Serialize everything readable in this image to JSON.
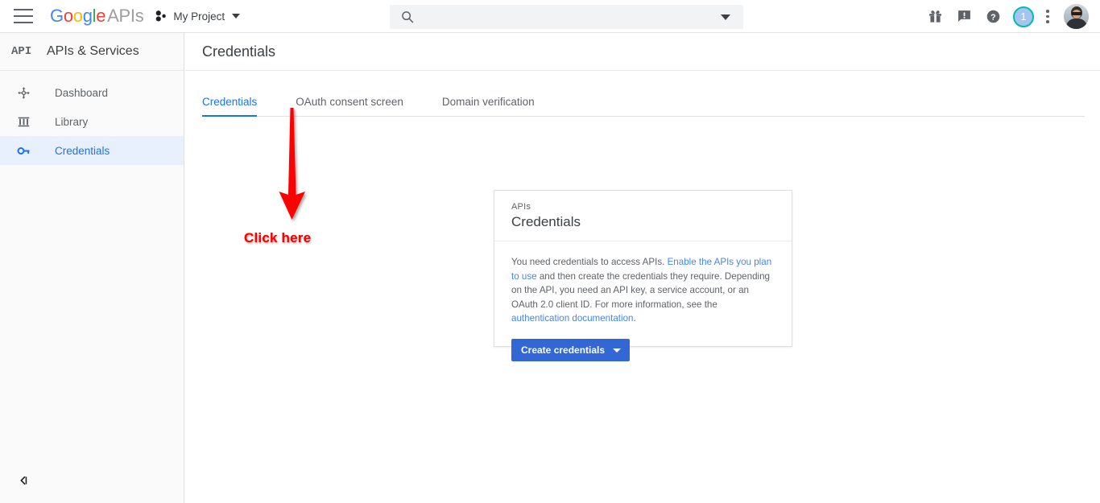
{
  "topbar": {
    "menu_icon": "hamburger-menu-icon",
    "brand": {
      "google": "Google",
      "apis": "APIs"
    },
    "project": {
      "icon": "project-cluster-icon",
      "name": "My Project"
    },
    "search": {
      "icon": "search-icon",
      "value": "",
      "placeholder": ""
    },
    "icons": [
      {
        "name": "gift-icon",
        "label": ""
      },
      {
        "name": "feedback-icon",
        "label": ""
      },
      {
        "name": "help-icon",
        "label": ""
      }
    ],
    "notification_badge": "1",
    "more_icon": "more-vertical-icon",
    "avatar": "user-avatar"
  },
  "sidebar": {
    "logo_text": "API",
    "title": "APIs & Services",
    "items": [
      {
        "label": "Dashboard",
        "icon": "dashboard-icon",
        "active": false
      },
      {
        "label": "Library",
        "icon": "library-icon",
        "active": false
      },
      {
        "label": "Credentials",
        "icon": "key-icon",
        "active": true
      }
    ],
    "collapse_icon": "collapse-sidebar-icon"
  },
  "main": {
    "page_title": "Credentials",
    "tabs": [
      {
        "label": "Credentials",
        "active": true
      },
      {
        "label": "OAuth consent screen",
        "active": false
      },
      {
        "label": "Domain verification",
        "active": false
      }
    ]
  },
  "card": {
    "eyebrow": "APIs",
    "title": "Credentials",
    "text_part1": "You need credentials to access APIs. ",
    "link1": "Enable the APIs you plan to use",
    "text_part2": " and then create the credentials they require. Depending on the API, you need an API key, a service account, or an OAuth 2.0 client ID. For more information, see the ",
    "link2": "authentication documentation",
    "text_part3": ".",
    "button_label": "Create credentials",
    "button_caret": "chevron-down-icon"
  },
  "annotation": {
    "arrow": "red-down-arrow",
    "text": "Click here"
  },
  "colors": {
    "accent_blue": "#1a73e8",
    "button_blue": "#3367d6",
    "link_blue": "#4285f4",
    "selected_nav_bg": "#e8f0fe",
    "annotation_red": "#ff0000",
    "badge_ring": "#00bfa5",
    "sidebar_bg": "#fafafa"
  }
}
